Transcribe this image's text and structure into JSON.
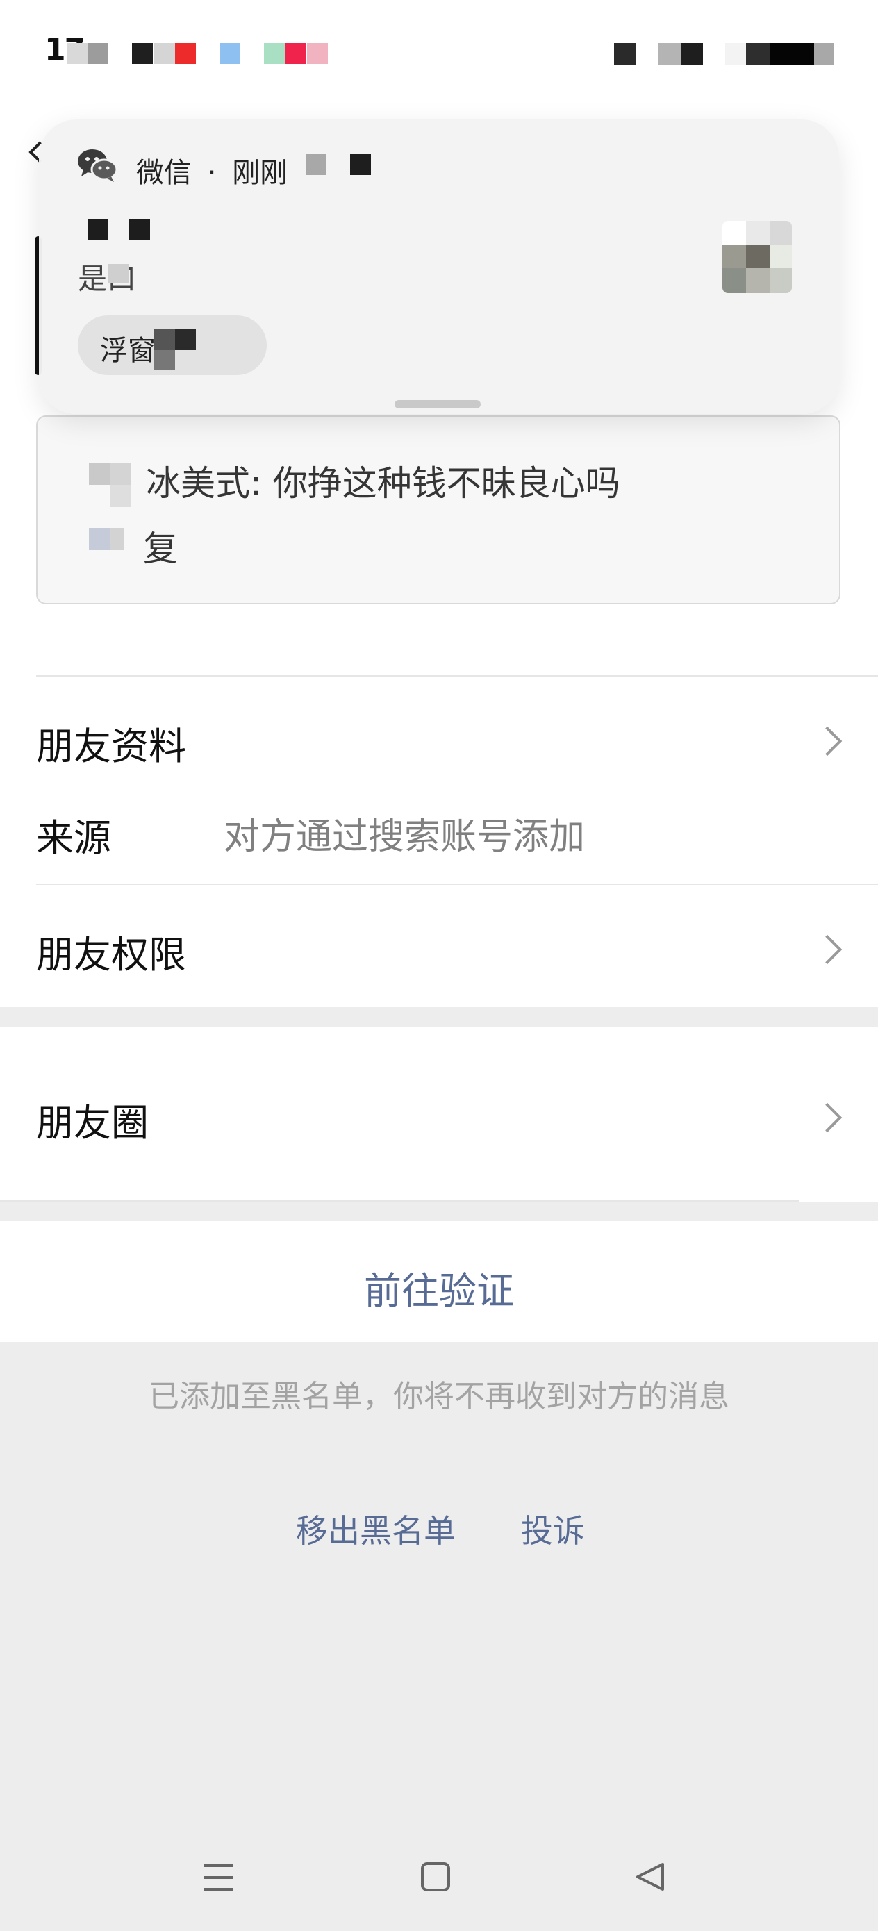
{
  "status_bar": {
    "time": "17"
  },
  "notification": {
    "app_name": "微信",
    "separator": "·",
    "time": "刚刚",
    "body_text": "是口",
    "chip_label": "浮窗"
  },
  "verification_message": {
    "line1": "冰美式: 你挣这种钱不昧良心吗",
    "line2": "复"
  },
  "friend_info": {
    "title": "朋友资料",
    "source_label": "来源",
    "source_value": "对方通过搜索账号添加"
  },
  "friend_permissions": {
    "label": "朋友权限"
  },
  "moments": {
    "label": "朋友圈"
  },
  "verify": {
    "label": "前往验证"
  },
  "blacklist": {
    "notice": "已添加至黑名单，你将不再收到对方的消息",
    "remove_label": "移出黑名单",
    "complain_label": "投诉"
  },
  "nav_bar": {
    "icons": [
      "menu-icon",
      "home-icon",
      "back-icon"
    ]
  },
  "colors": {
    "link": "#576b95",
    "background": "#ededed",
    "card": "#ffffff"
  }
}
